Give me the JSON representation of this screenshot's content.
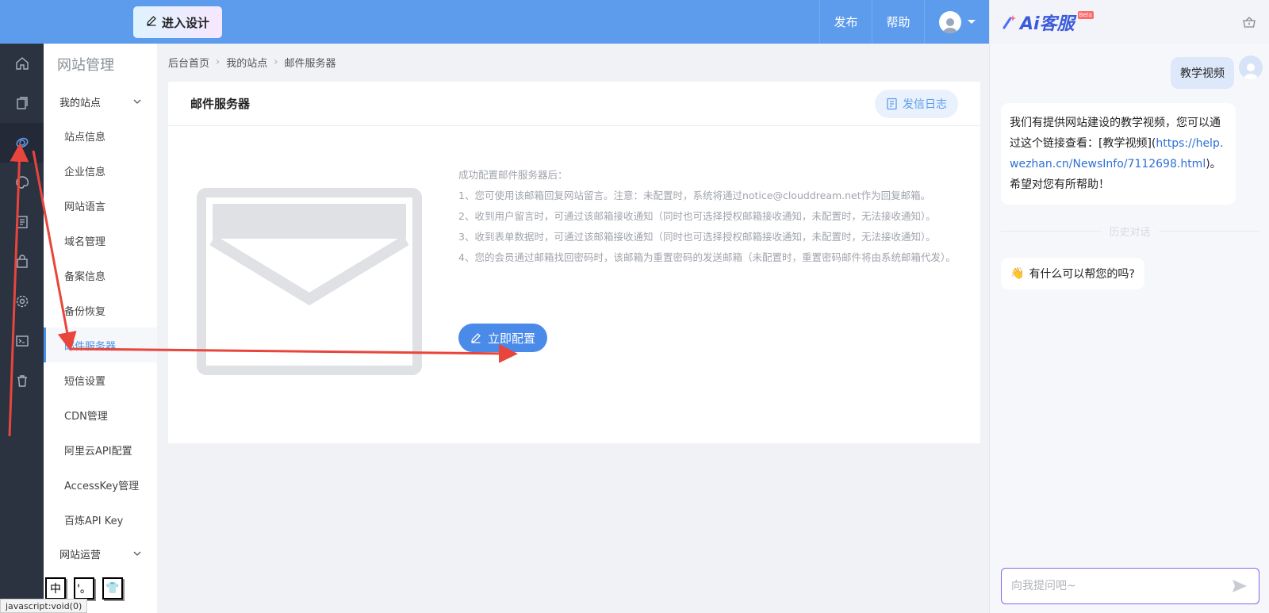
{
  "topbar": {
    "design_button": "进入设计",
    "publish": "发布",
    "help": "帮助"
  },
  "rail": {
    "icons": [
      "home-icon",
      "pages-icon",
      "site-icon",
      "palette-icon",
      "article-icon",
      "bag-icon",
      "settings-icon",
      "terminal-icon",
      "trash-icon"
    ]
  },
  "submenu": {
    "title": "网站管理",
    "group_my_sites": "我的站点",
    "items": [
      "站点信息",
      "企业信息",
      "网站语言",
      "域名管理",
      "备案信息",
      "备份恢复",
      "邮件服务器",
      "短信设置",
      "CDN管理",
      "阿里云API配置",
      "AccessKey管理",
      "百炼API Key"
    ],
    "group_operations": "网站运营"
  },
  "breadcrumb": [
    "后台首页",
    "我的站点",
    "邮件服务器"
  ],
  "card": {
    "title": "邮件服务器",
    "log_button": "发信日志",
    "info_title": "成功配置邮件服务器后：",
    "info_lines": [
      "1、您可使用该邮箱回复网站留言。注意：未配置时，系统将通过notice@clouddream.net作为回复邮箱。",
      "2、收到用户留言时，可通过该邮箱接收通知（同时也可选择授权邮箱接收通知，未配置时，无法接收通知）。",
      "3、收到表单数据时，可通过该邮箱接收通知（同时也可选择授权邮箱接收通知，未配置时，无法接收通知）。",
      "4、您的会员通过邮箱找回密码时，该邮箱为重置密码的发送邮箱（未配置时，重置密码邮件将由系统邮箱代发）。"
    ],
    "config_button": "立即配置"
  },
  "ai_panel": {
    "brand": "Ai客服",
    "beta": "Beta",
    "user_message": "教学视频",
    "bot_message_prefix": "我们有提供网站建设的教学视频，您可以通过这个链接查看：[教学视频](",
    "bot_message_link": "https://help.wezhan.cn/NewsInfo/7112698.html",
    "bot_message_suffix": ")。希望对您有所帮助！",
    "history_label": "历史对话",
    "greeting": "有什么可以帮您的吗?",
    "greeting_emoji": "👋",
    "input_placeholder": "向我提问吧~"
  },
  "ime": [
    "中",
    "'。",
    "👕"
  ],
  "status_bar": "javascript:void(0)",
  "colors": {
    "topbar": "#5d9cec",
    "rail": "#2b3240",
    "accent": "#4a8ae8",
    "annotation": "#e8453c"
  }
}
